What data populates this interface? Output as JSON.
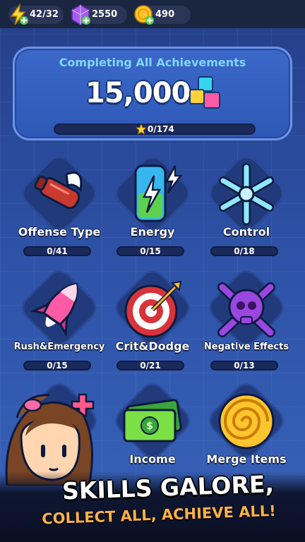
{
  "resources": [
    {
      "icon": "energy-bolt-icon",
      "value": "42/32"
    },
    {
      "icon": "purple-gem-icon",
      "value": "2550"
    },
    {
      "icon": "gold-coin-icon",
      "value": "490"
    }
  ],
  "achievement": {
    "title": "Completing All Achievements",
    "reward": "15,000",
    "progress": "0/174",
    "progress_fraction": 0
  },
  "categories": [
    {
      "name": "Offense Type",
      "progress": "0/41",
      "icon": "rocket-punch-icon"
    },
    {
      "name": "Energy",
      "progress": "0/15",
      "icon": "battery-bolt-icon"
    },
    {
      "name": "Control",
      "progress": "0/18",
      "icon": "snowflake-icon"
    },
    {
      "name": "Rush&Emergency",
      "progress": "0/15",
      "icon": "pink-rocket-icon"
    },
    {
      "name": "Crit&Dodge",
      "progress": "0/21",
      "icon": "target-arrow-icon"
    },
    {
      "name": "Negative Effects",
      "progress": "0/13",
      "icon": "skull-crossbones-icon"
    },
    {
      "name": "",
      "progress": "",
      "icon": "heal-plus-icon"
    },
    {
      "name": "Income",
      "progress": "",
      "icon": "cash-icon"
    },
    {
      "name": "Merge Items",
      "progress": "",
      "icon": "swirl-icon"
    }
  ],
  "promo": {
    "line1": "SKILLS GALORE,",
    "line2": "COLLECT ALL, ACHIEVE ALL!"
  },
  "colors": {
    "background": "#2c4ca0",
    "accent_title": "#7fd6ff",
    "promo_orange": "#ffb24a"
  }
}
